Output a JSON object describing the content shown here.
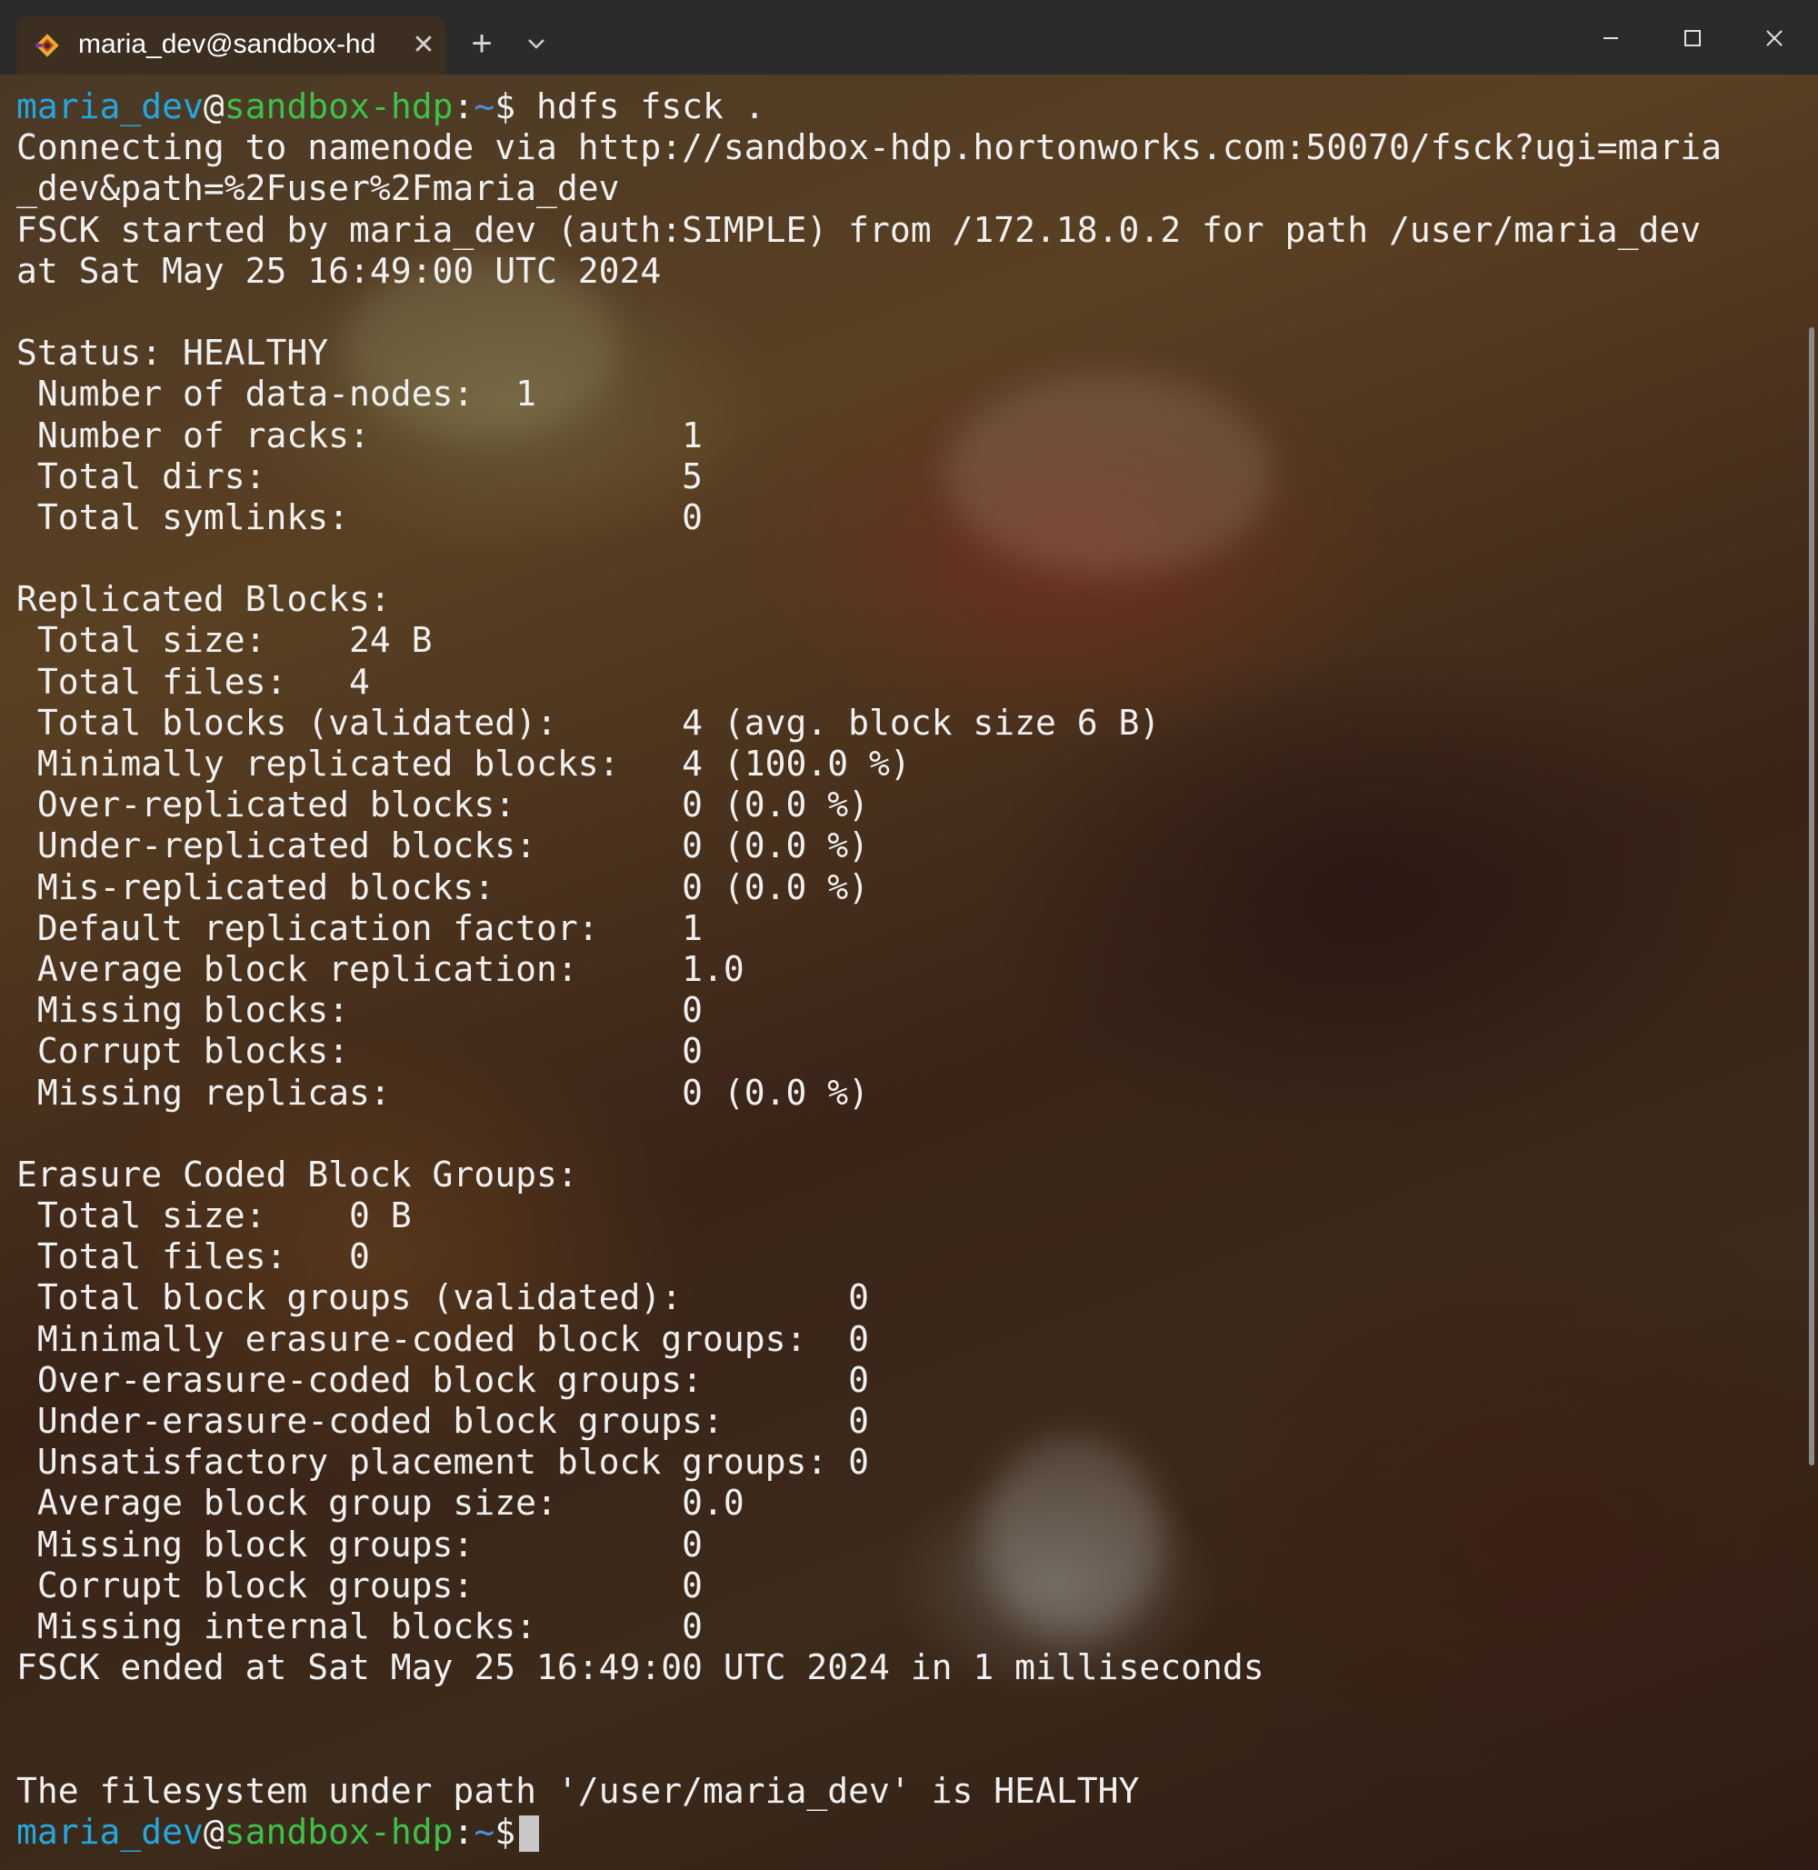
{
  "window": {
    "tab_title": "maria_dev@sandbox-hd",
    "tab_close": "✕",
    "new_tab": "+"
  },
  "prompt": {
    "user": "maria_dev",
    "at": "@",
    "host": "sandbox-hdp",
    "sep": ":",
    "path": "~",
    "dollar": "$",
    "command": " hdfs fsck ."
  },
  "output": [
    "Connecting to namenode via http://sandbox-hdp.hortonworks.com:50070/fsck?ugi=maria",
    "_dev&path=%2Fuser%2Fmaria_dev",
    "FSCK started by maria_dev (auth:SIMPLE) from /172.18.0.2 for path /user/maria_dev",
    "at Sat May 25 16:49:00 UTC 2024",
    "",
    "Status: HEALTHY",
    " Number of data-nodes:  1",
    " Number of racks:               1",
    " Total dirs:                    5",
    " Total symlinks:                0",
    "",
    "Replicated Blocks:",
    " Total size:    24 B",
    " Total files:   4",
    " Total blocks (validated):      4 (avg. block size 6 B)",
    " Minimally replicated blocks:   4 (100.0 %)",
    " Over-replicated blocks:        0 (0.0 %)",
    " Under-replicated blocks:       0 (0.0 %)",
    " Mis-replicated blocks:         0 (0.0 %)",
    " Default replication factor:    1",
    " Average block replication:     1.0",
    " Missing blocks:                0",
    " Corrupt blocks:                0",
    " Missing replicas:              0 (0.0 %)",
    "",
    "Erasure Coded Block Groups:",
    " Total size:    0 B",
    " Total files:   0",
    " Total block groups (validated):        0",
    " Minimally erasure-coded block groups:  0",
    " Over-erasure-coded block groups:       0",
    " Under-erasure-coded block groups:      0",
    " Unsatisfactory placement block groups: 0",
    " Average block group size:      0.0",
    " Missing block groups:          0",
    " Corrupt block groups:          0",
    " Missing internal blocks:       0",
    "FSCK ended at Sat May 25 16:49:00 UTC 2024 in 1 milliseconds",
    "",
    "",
    "The filesystem under path '/user/maria_dev' is HEALTHY"
  ],
  "colors": {
    "user": "#22a8e0",
    "host": "#3cc24a",
    "text": "#f0f0f0",
    "titlebar": "#2b2b2b",
    "tab": "#3c2f22"
  },
  "icons": {
    "tab_icon": "git-bash-diamond-icon",
    "dropdown": "chevron-down-icon",
    "minimize": "minimize-icon",
    "maximize": "maximize-icon",
    "close": "close-icon"
  }
}
